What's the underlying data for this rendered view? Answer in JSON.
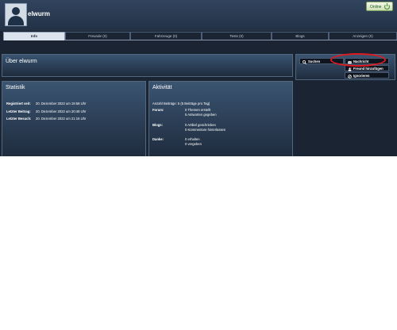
{
  "header": {
    "username": "elwurm",
    "status": "Online"
  },
  "tabs": [
    {
      "label": "Info"
    },
    {
      "label": "Freunde (0)"
    },
    {
      "label": "Fahrzeuge (0)"
    },
    {
      "label": "Tests (0)"
    },
    {
      "label": "Blogs"
    },
    {
      "label": "Anzeigen (0)"
    }
  ],
  "about": {
    "title": "Über elwurm"
  },
  "actions": {
    "search": "Suchen",
    "message": "Nachricht",
    "friend": "Freund hinzufügen",
    "ignore": "Ignorieren"
  },
  "stats": {
    "title": "Statistik",
    "rows": [
      {
        "label": "Registriert seit:",
        "value": "20. Dezember 2022 um 19:58 Uhr"
      },
      {
        "label": "Letzter Beitrag:",
        "value": "20. Dezember 2022 um 20:48 Uhr"
      },
      {
        "label": "Letzter Besuch:",
        "value": "20. Dezember 2022 um 21:16 Uhr"
      }
    ]
  },
  "activity": {
    "title": "Aktivität",
    "summary": "Anzahl Beiträge: 5 (5 Beiträge pro Tag)",
    "forum_label": "Forum:",
    "forum_1": "0 Themen erstellt",
    "forum_2": "5 Antworten gegeben",
    "blogs_label": "Blogs:",
    "blogs_1": "0 Artikel geschrieben",
    "blogs_2": "0 Kommentare hinterlassen",
    "thanks_label": "Danke:",
    "thanks_1": "0 erhalten",
    "thanks_2": "0 vergeben"
  },
  "colors": {
    "highlight": "#e0191f",
    "background": "#1b2433"
  }
}
